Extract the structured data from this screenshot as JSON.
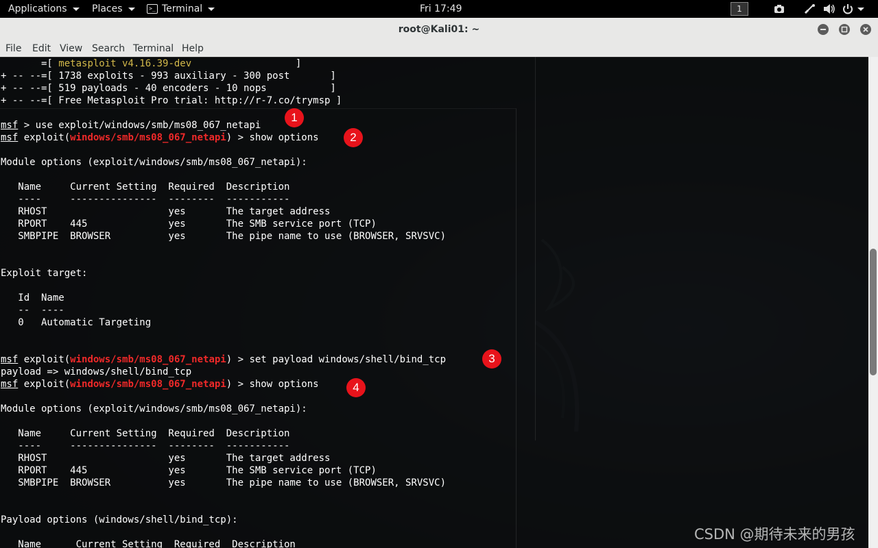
{
  "topbar": {
    "applications": "Applications",
    "places": "Places",
    "terminal": "Terminal",
    "clock": "Fri 17:49",
    "workspace": "1"
  },
  "window": {
    "title": "root@Kali01: ~"
  },
  "menu": [
    "File",
    "Edit",
    "View",
    "Search",
    "Terminal",
    "Help"
  ],
  "terminal": {
    "banner": [
      {
        "pre": "       =[ ",
        "hi": "metasploit v4.16.39-dev",
        "post": "                  ]"
      },
      {
        "pre": "+ -- --=[ 1738 exploits - 993 auxiliary - 300 post       ]"
      },
      {
        "pre": "+ -- --=[ 519 payloads - 40 encoders - 10 nops           ]"
      },
      {
        "pre": "+ -- --=[ Free Metasploit Pro trial: http://r-7.co/trymsp ]"
      }
    ],
    "prompt": "msf",
    "module": "windows/smb/ms08_067_netapi",
    "cmd1": " > use exploit/windows/smb/ms08_067_netapi",
    "exploit_open": " exploit(",
    "exploit_close": ") > ",
    "cmd2": "show options",
    "cmd3": "set payload windows/shell/bind_tcp",
    "cmd4": "show options",
    "module_options": "Module options (exploit/windows/smb/ms08_067_netapi):",
    "table_header": "   Name     Current Setting  Required  Description",
    "table_sep": "   ----     ---------------  --------  -----------",
    "rows": [
      "   RHOST                     yes       The target address",
      "   RPORT    445              yes       The SMB service port (TCP)",
      "   SMBPIPE  BROWSER          yes       The pipe name to use (BROWSER, SRVSVC)"
    ],
    "exploit_target": "Exploit target:",
    "target_header": "   Id  Name",
    "target_sep": "   --  ----",
    "target_row": "   0   Automatic Targeting",
    "payload_result": "payload => windows/shell/bind_tcp",
    "payload_options": "Payload options (windows/shell/bind_tcp):",
    "payload_header": "   Name      Current Setting  Required  Description"
  },
  "markers": [
    "1",
    "2",
    "3",
    "4"
  ],
  "watermark": "CSDN @期待未来的男孩"
}
